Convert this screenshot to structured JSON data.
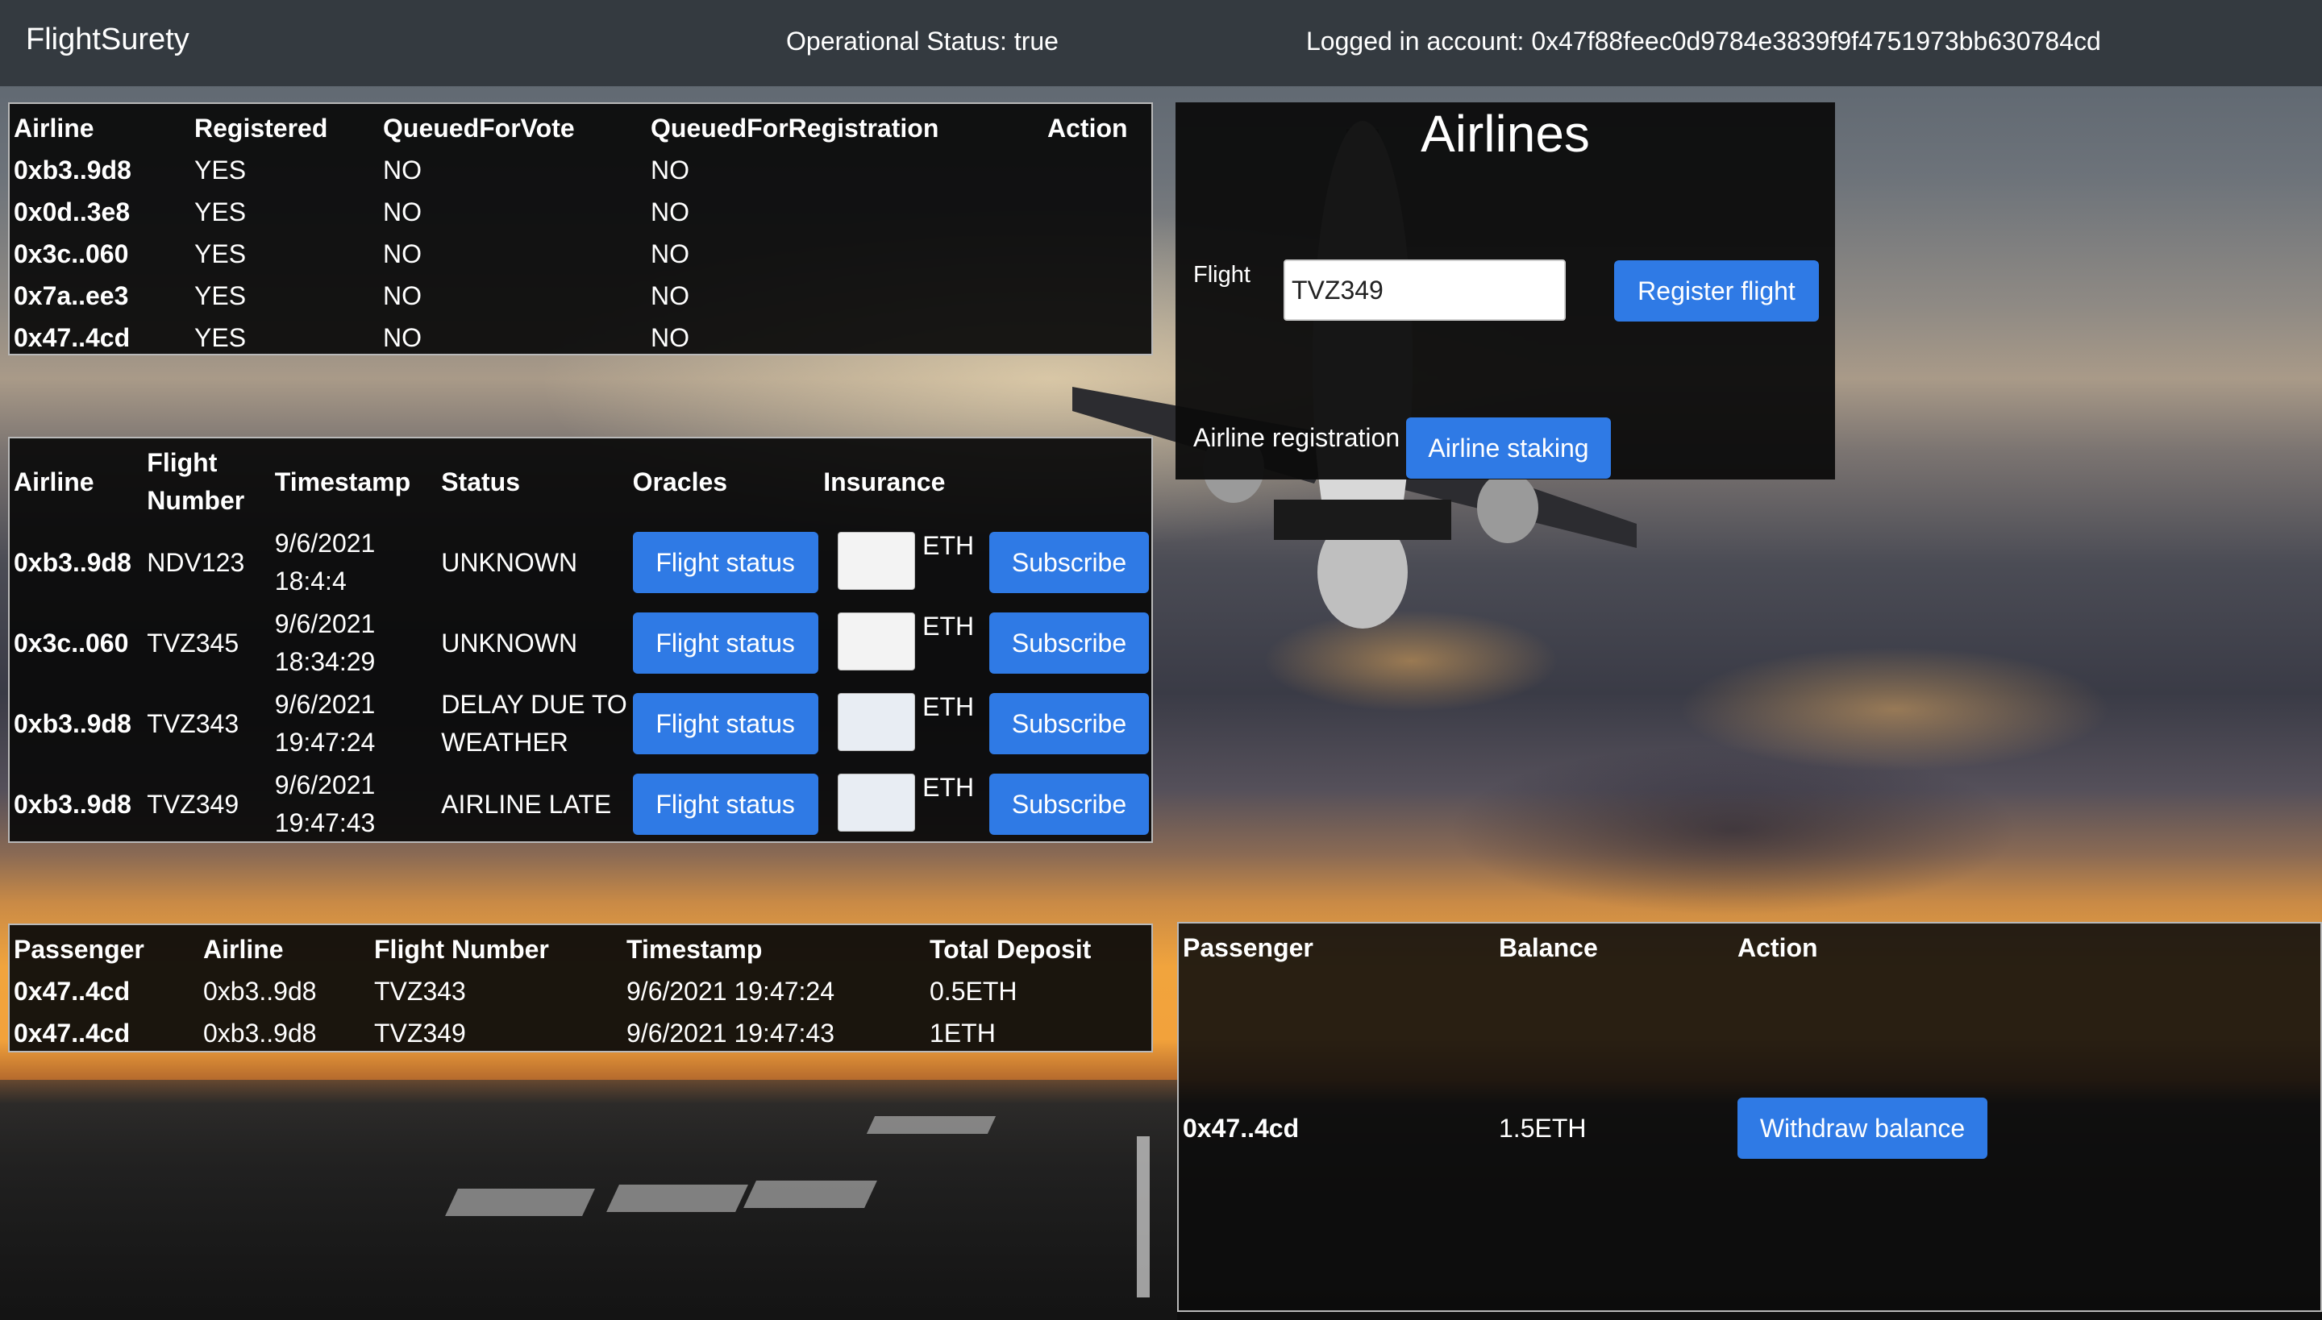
{
  "navbar": {
    "brand": "FlightSurety",
    "operational_status": "Operational Status: true",
    "logged_in": "Logged in account: 0x47f88feec0d9784e3839f9f4751973bb630784cd"
  },
  "airlines_table": {
    "headers": [
      "Airline",
      "Registered",
      "QueuedForVote",
      "QueuedForRegistration",
      "Action"
    ],
    "rows": [
      {
        "airline": "0xb3..9d8",
        "registered": "YES",
        "queued_vote": "NO",
        "queued_registration": "NO"
      },
      {
        "airline": "0x0d..3e8",
        "registered": "YES",
        "queued_vote": "NO",
        "queued_registration": "NO"
      },
      {
        "airline": "0x3c..060",
        "registered": "YES",
        "queued_vote": "NO",
        "queued_registration": "NO"
      },
      {
        "airline": "0x7a..ee3",
        "registered": "YES",
        "queued_vote": "NO",
        "queued_registration": "NO"
      },
      {
        "airline": "0x47..4cd",
        "registered": "YES",
        "queued_vote": "NO",
        "queued_registration": "NO"
      }
    ]
  },
  "flights_table": {
    "headers": [
      "Airline",
      "Flight Number",
      "Timestamp",
      "Status",
      "Oracles",
      "Insurance"
    ],
    "flight_status_label": "Flight status",
    "subscribe_label": "Subscribe",
    "eth_label": "ETH",
    "rows": [
      {
        "airline": "0xb3..9d8",
        "flight": "NDV123",
        "date": "9/6/2021",
        "time": "18:4:4",
        "status": "UNKNOWN"
      },
      {
        "airline": "0x3c..060",
        "flight": "TVZ345",
        "date": "9/6/2021",
        "time": "18:34:29",
        "status": "UNKNOWN"
      },
      {
        "airline": "0xb3..9d8",
        "flight": "TVZ343",
        "date": "9/6/2021",
        "time": "19:47:24",
        "status": "DELAY DUE TO WEATHER"
      },
      {
        "airline": "0xb3..9d8",
        "flight": "TVZ349",
        "date": "9/6/2021",
        "time": "19:47:43",
        "status": "AIRLINE LATE"
      }
    ]
  },
  "airlines_panel": {
    "title": "Airlines",
    "flight_label": "Flight",
    "flight_value": "TVZ349",
    "register_flight_label": "Register flight",
    "airline_registration_label": "Airline registration",
    "airline_staking_label": "Airline staking"
  },
  "passengers_table": {
    "headers": [
      "Passenger",
      "Airline",
      "Flight Number",
      "Timestamp",
      "Total Deposit"
    ],
    "rows": [
      {
        "passenger": "0x47..4cd",
        "airline": "0xb3..9d8",
        "flight": "TVZ343",
        "timestamp": "9/6/2021 19:47:24",
        "deposit": "0.5ETH"
      },
      {
        "passenger": "0x47..4cd",
        "airline": "0xb3..9d8",
        "flight": "TVZ349",
        "timestamp": "9/6/2021 19:47:43",
        "deposit": "1ETH"
      }
    ]
  },
  "balance_table": {
    "headers": [
      "Passenger",
      "Balance",
      "Action"
    ],
    "rows": [
      {
        "passenger": "0x47..4cd",
        "balance": "1.5ETH",
        "action_label": "Withdraw balance"
      }
    ]
  },
  "colors": {
    "navbar": "#343a40",
    "button": "#2f7ae5",
    "panel": "#0a0a0a"
  }
}
